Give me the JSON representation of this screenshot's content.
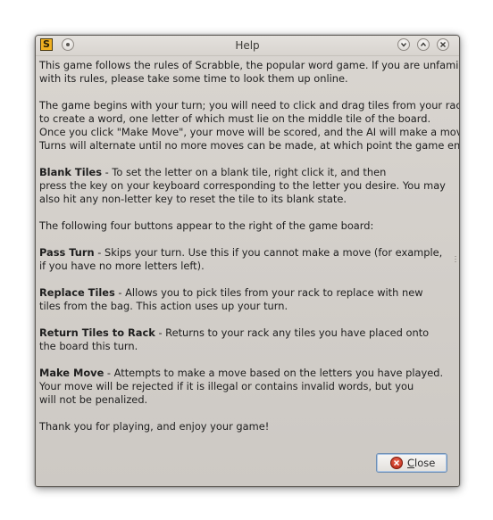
{
  "window": {
    "title": "Help",
    "app_icon_letter": "S"
  },
  "icons": {
    "app": "scrabble-app-icon",
    "menu": "window-menu-icon",
    "minimize": "chevron-down-icon",
    "maximize": "chevron-up-icon",
    "close": "close-x-icon",
    "close_button": "close-circle-icon"
  },
  "help": {
    "intro": [
      "This game follows the rules of Scrabble, the popular word game. If you are unfamiliar",
      "with its rules, please take some time to look them up online."
    ],
    "gameplay": [
      "The game begins with your turn; you will need to click and drag tiles from your rack",
      "to create a word, one letter of which must lie on the middle tile of the board.",
      "Once you click \"Make Move\", your move will be scored, and the AI will make a move.",
      "Turns will alternate until no more moves can be made, at which point the game ends."
    ],
    "blank_tiles": {
      "title": "Blank Tiles",
      "line1": " - To set the letter on a blank tile, right click it, and then",
      "lines": [
        "press the key on your keyboard corresponding to the letter you desire. You may",
        "also hit any non-letter key to reset the tile to its blank state."
      ]
    },
    "buttons_intro": "The following four buttons appear to the right of the game board:",
    "pass_turn": {
      "title": "Pass Turn",
      "line1": " - Skips your turn. Use this if you cannot make a move (for example,",
      "lines": [
        "if you have no more letters left)."
      ]
    },
    "replace_tiles": {
      "title": "Replace Tiles",
      "line1": " - Allows you to pick tiles from your rack to replace with new",
      "lines": [
        "tiles from the bag. This action uses up your turn."
      ]
    },
    "return_tiles": {
      "title": "Return Tiles to Rack",
      "line1": " - Returns to your rack any tiles you have placed onto",
      "lines": [
        "the board this turn."
      ]
    },
    "make_move": {
      "title": "Make Move",
      "line1": " - Attempts to make a move based on the letters you have played.",
      "lines": [
        "Your move will be rejected if it is illegal or contains invalid words, but you",
        "will not be penalized."
      ]
    },
    "outro": "Thank you for playing, and enjoy your game!"
  },
  "buttons": {
    "close_mnemonic": "C",
    "close_rest": "lose"
  },
  "colors": {
    "close_icon": "#c9301c",
    "focus_border": "#6f8fb3"
  }
}
